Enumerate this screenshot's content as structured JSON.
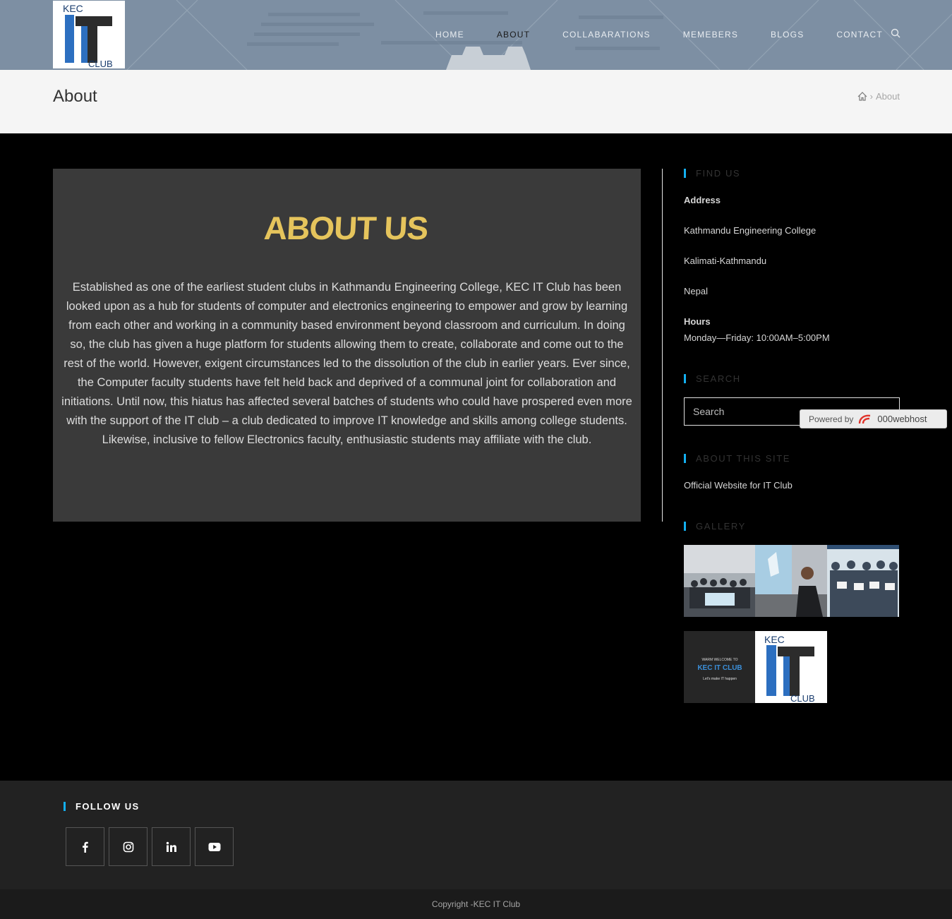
{
  "nav": {
    "items": [
      {
        "label": "HOME",
        "active": false
      },
      {
        "label": "ABOUT",
        "active": true
      },
      {
        "label": "COLLABARATIONS",
        "active": false
      },
      {
        "label": "MEMEBERS",
        "active": false
      },
      {
        "label": "BLOGS",
        "active": false
      },
      {
        "label": "CONTACT",
        "active": false
      }
    ]
  },
  "logo": {
    "top": "KEC",
    "big": "IT",
    "bottom": "CLUB"
  },
  "page_header": {
    "title": "About",
    "breadcrumb_current": "About"
  },
  "content": {
    "heading": "ABOUT US",
    "paragraph": "Established as one of the earliest student clubs in Kathmandu Engineering College, KEC IT Club has been looked upon as a hub for students of computer and electronics engineering to empower and grow by learning from each other and working in a community based environment beyond classroom and curriculum. In doing so, the club has given a huge platform for students allowing them to create, collaborate and come out to the rest of the world. However, exigent circumstances led to the dissolution of the club in earlier years. Ever since, the Computer faculty students have felt held back and deprived of a communal joint for collaboration and initiations. Until now, this hiatus has affected several batches of students who could have prospered even more with the support of the IT club – a club dedicated to improve IT knowledge and skills among college students. Likewise, inclusive to fellow Electronics faculty, enthusiastic students may affiliate with the club."
  },
  "sidebar": {
    "find_us": {
      "title": "FIND US",
      "address_label": "Address",
      "address_lines": [
        "Kathmandu Engineering College",
        "Kalimati-Kathmandu",
        "Nepal"
      ],
      "hours_label": "Hours",
      "hours": "Monday—Friday: 10:00AM–5:00PM"
    },
    "search": {
      "title": "SEARCH",
      "placeholder": "Search"
    },
    "about_site": {
      "title": "ABOUT THIS SITE",
      "text": "Official Website for IT Club"
    },
    "gallery": {
      "title": "GALLERY",
      "welcome_small": "WARM WELCOME TO",
      "welcome_big": "KEC IT CLUB",
      "welcome_tag": "Let's make IT happen"
    }
  },
  "powered": {
    "prefix": "Powered by",
    "brand": "000webhost"
  },
  "footer": {
    "follow_title": "FOLLOW US",
    "social": [
      "facebook",
      "instagram",
      "linkedin",
      "youtube"
    ],
    "copyright": "Copyright -KEC IT Club"
  },
  "colors": {
    "accent": "#13aff0",
    "heading_gold": "#e5c45c",
    "header_bg": "#7d8fa3"
  }
}
